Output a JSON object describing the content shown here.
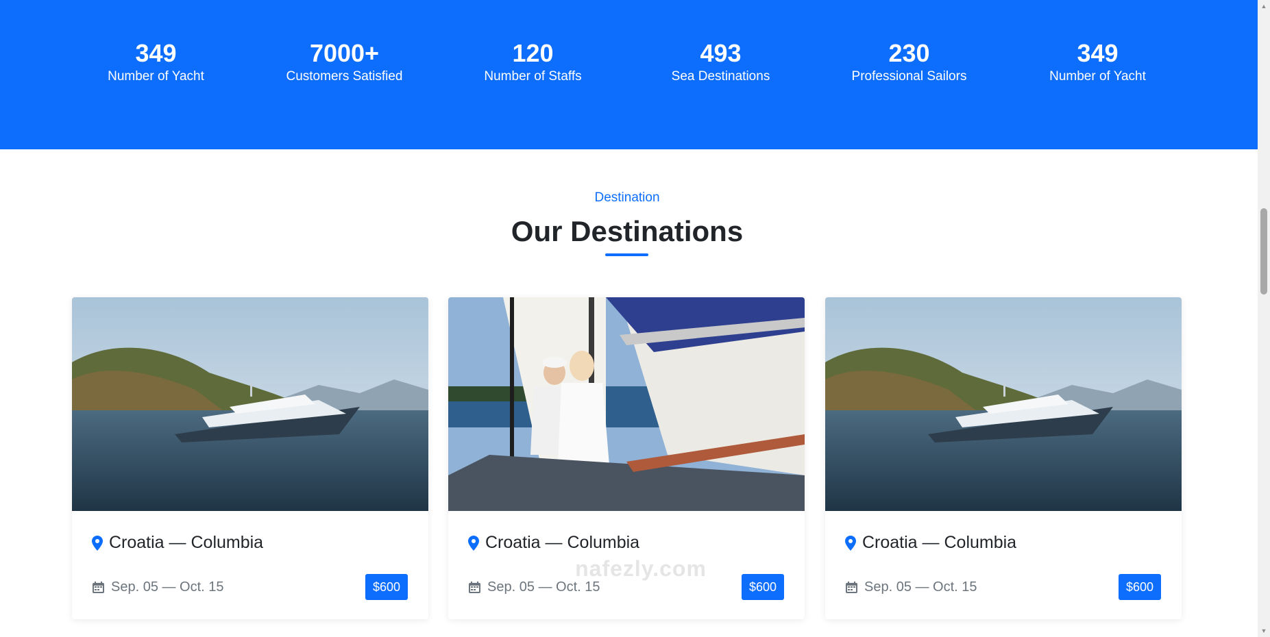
{
  "stats": [
    {
      "value": "349",
      "label": "Number of Yacht"
    },
    {
      "value": "7000+",
      "label": "Customers Satisfied"
    },
    {
      "value": "120",
      "label": "Number of Staffs"
    },
    {
      "value": "493",
      "label": "Sea Destinations"
    },
    {
      "value": "230",
      "label": "Professional Sailors"
    },
    {
      "value": "349",
      "label": "Number of Yacht"
    }
  ],
  "section": {
    "kicker": "Destination",
    "title": "Our Destinations"
  },
  "cards": [
    {
      "route": "Croatia — Columbia",
      "dates": "Sep. 05 — Oct. 15",
      "price": "$600",
      "image": "yacht-on-sea"
    },
    {
      "route": "Croatia — Columbia",
      "dates": "Sep. 05 — Oct. 15",
      "price": "$600",
      "image": "couple-on-sailboat"
    },
    {
      "route": "Croatia — Columbia",
      "dates": "Sep. 05 — Oct. 15",
      "price": "$600",
      "image": "yacht-on-sea"
    }
  ],
  "watermark": {
    "text": "nafezly.com"
  },
  "colors": {
    "accent": "#0d6efd",
    "muted": "#6c757d",
    "title": "#212529"
  },
  "icons": {
    "location": "map-pin-icon",
    "date": "calendar-icon"
  }
}
